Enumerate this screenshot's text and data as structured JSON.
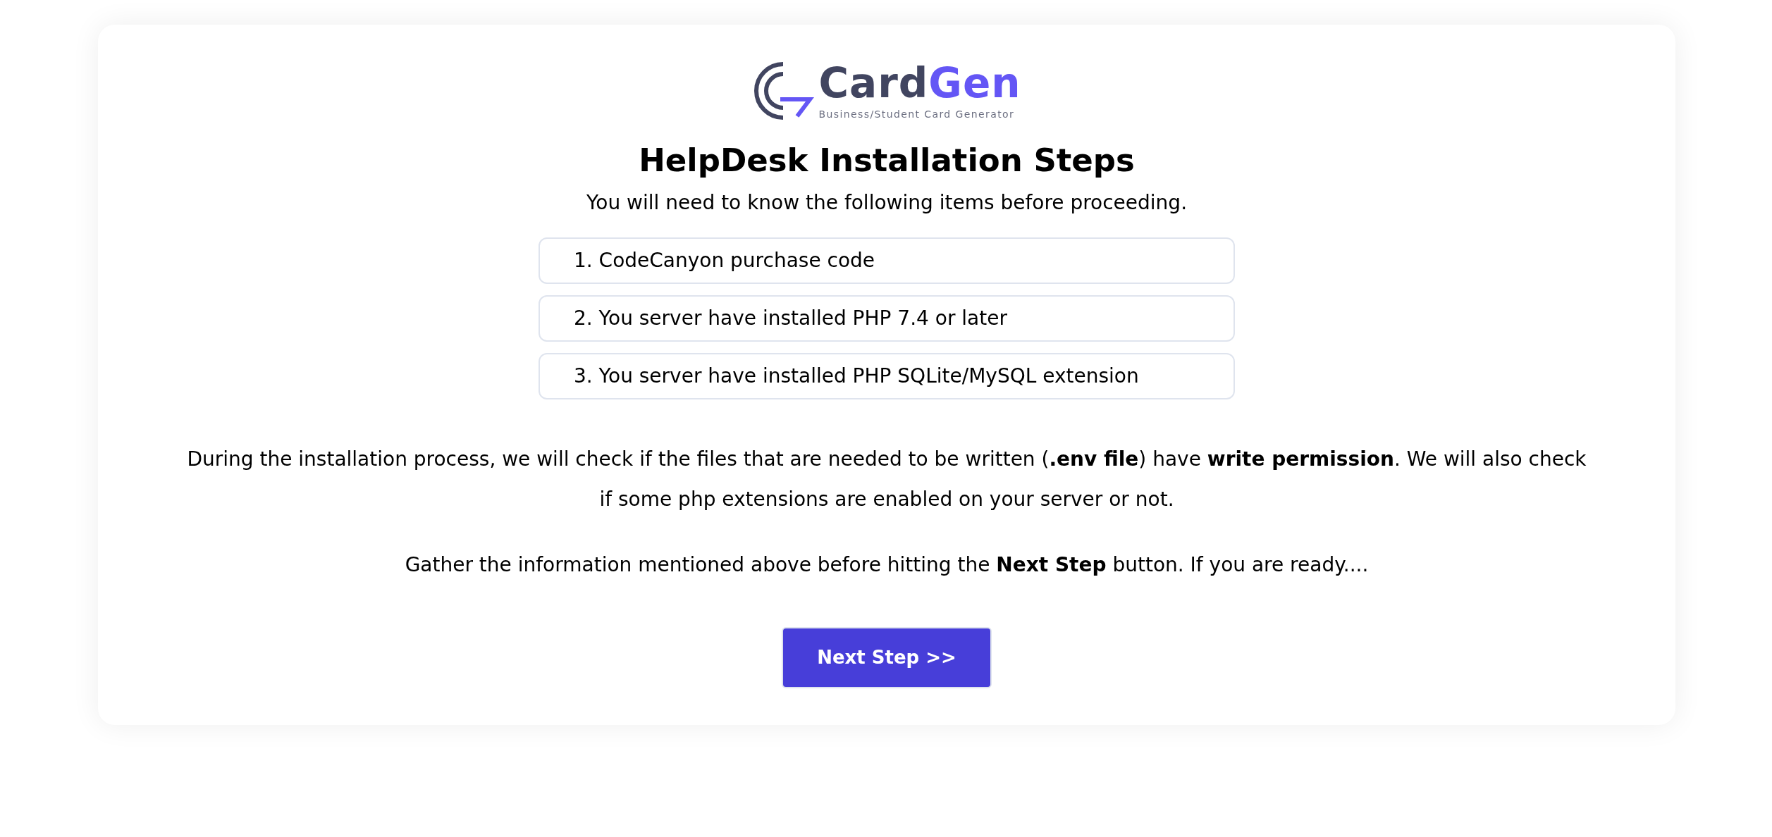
{
  "logo": {
    "name_primary": "Card",
    "name_accent": "Gen",
    "tagline": "Business/Student Card Generator"
  },
  "title": "HelpDesk Installation Steps",
  "subtitle": "You will need to know the following items before proceeding.",
  "requirements": [
    "1. CodeCanyon purchase code",
    "2. You server have installed PHP 7.4 or later",
    "3. You server have installed PHP SQLite/MySQL extension"
  ],
  "paragraphs": [
    "During the installation process, we will check if the files that are needed to be written (**.env file**) have **write permission**. We will also check if some php extensions are enabled on your server or not.",
    "Gather the information mentioned above before hitting the **Next Step** button. If you are ready...."
  ],
  "button": "Next Step >>"
}
